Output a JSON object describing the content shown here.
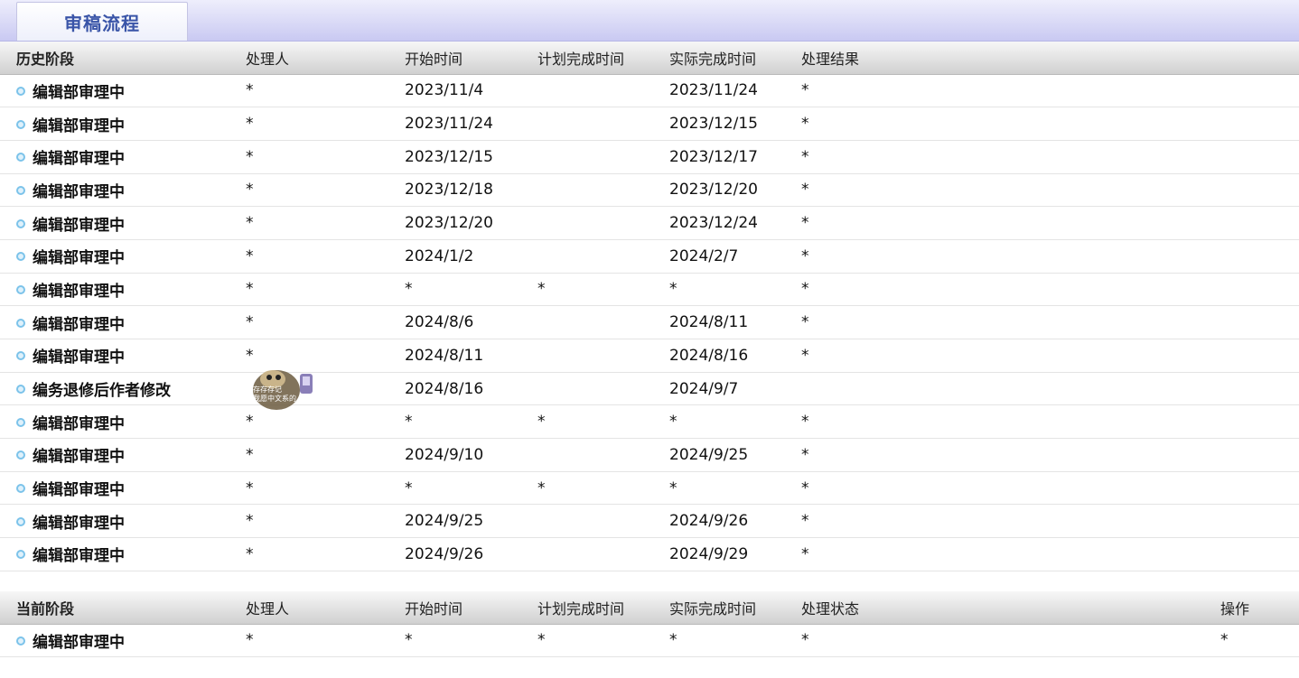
{
  "tab": {
    "title": "审稿流程"
  },
  "history": {
    "headers": [
      "历史阶段",
      "处理人",
      "开始时间",
      "计划完成时间",
      "实际完成时间",
      "处理结果"
    ],
    "rows": [
      [
        "编辑部审理中",
        "*",
        "2023/11/4",
        "",
        "2023/11/24",
        "*"
      ],
      [
        "编辑部审理中",
        "*",
        "2023/11/24",
        "",
        "2023/12/15",
        "*"
      ],
      [
        "编辑部审理中",
        "*",
        "2023/12/15",
        "",
        "2023/12/17",
        "*"
      ],
      [
        "编辑部审理中",
        "*",
        "2023/12/18",
        "",
        "2023/12/20",
        "*"
      ],
      [
        "编辑部审理中",
        "*",
        "2023/12/20",
        "",
        "2023/12/24",
        "*"
      ],
      [
        "编辑部审理中",
        "*",
        "2024/1/2",
        "",
        "2024/2/7",
        "*"
      ],
      [
        "编辑部审理中",
        "*",
        "*",
        "*",
        "*",
        "*"
      ],
      [
        "编辑部审理中",
        "*",
        "2024/8/6",
        "",
        "2024/8/11",
        "*"
      ],
      [
        "编辑部审理中",
        "*",
        "2024/8/11",
        "",
        "2024/8/16",
        "*"
      ],
      [
        "编务退修后作者修改",
        "",
        "2024/8/16",
        "",
        "2024/9/7",
        ""
      ],
      [
        "编辑部审理中",
        "*",
        "*",
        "*",
        "*",
        "*"
      ],
      [
        "编辑部审理中",
        "*",
        "2024/9/10",
        "",
        "2024/9/25",
        "*"
      ],
      [
        "编辑部审理中",
        "*",
        "*",
        "*",
        "*",
        "*"
      ],
      [
        "编辑部审理中",
        "*",
        "2024/9/25",
        "",
        "2024/9/26",
        "*"
      ],
      [
        "编辑部审理中",
        "*",
        "2024/9/26",
        "",
        "2024/9/29",
        "*"
      ]
    ]
  },
  "current": {
    "headers": [
      "当前阶段",
      "处理人",
      "开始时间",
      "计划完成时间",
      "实际完成时间",
      "处理状态",
      "",
      "操作"
    ],
    "rows": [
      [
        "编辑部审理中",
        "*",
        "*",
        "*",
        "*",
        "*",
        "",
        "*"
      ]
    ]
  },
  "watermark": {
    "line1": "存存存记",
    "line2": "我愿中文系的"
  },
  "colors": {
    "tab_text": "#3a55a8",
    "bullet": "#7cc3ea",
    "header_bg": "#d0d0d0",
    "tabbar_bg": "#c9c9f2"
  }
}
